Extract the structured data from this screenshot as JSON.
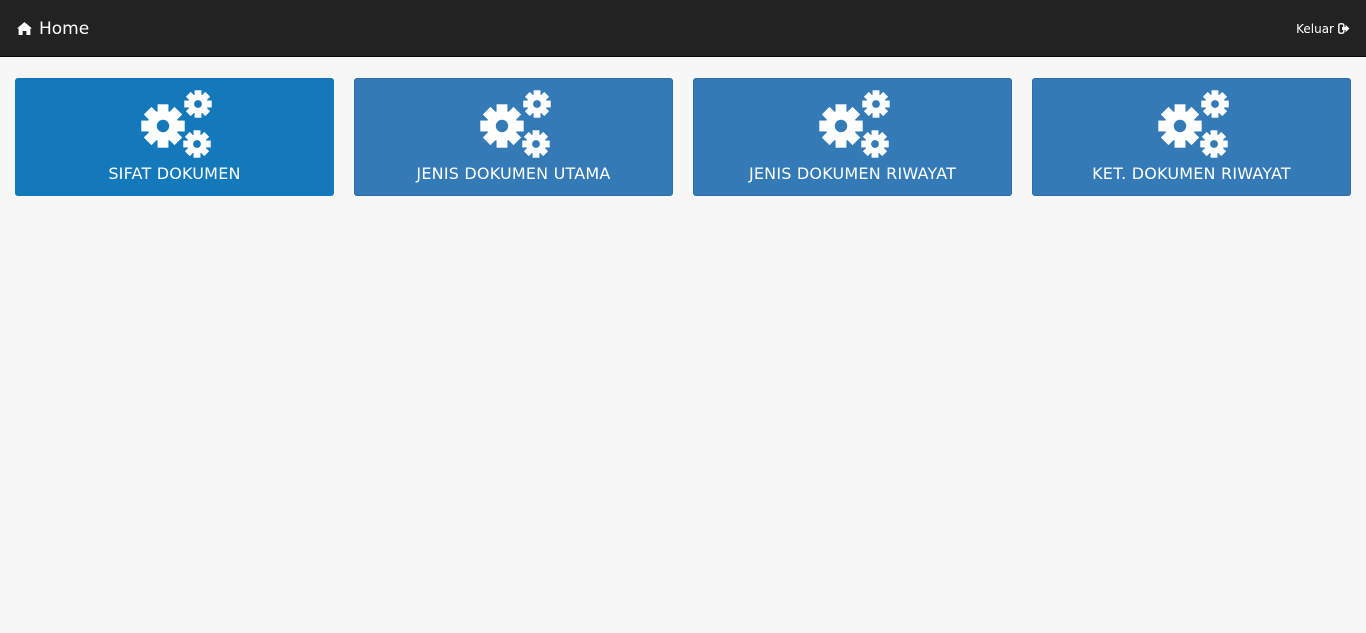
{
  "navbar": {
    "brand_label": "Home",
    "brand_icon": "home-icon",
    "logout_label": "Keluar",
    "logout_icon": "sign-out-icon"
  },
  "tiles": [
    {
      "label": "SIFAT DOKUMEN",
      "icon": "gears-icon",
      "active": true
    },
    {
      "label": "JENIS DOKUMEN UTAMA",
      "icon": "gears-icon",
      "active": false
    },
    {
      "label": "JENIS DOKUMEN RIWAYAT",
      "icon": "gears-icon",
      "active": false
    },
    {
      "label": "KET. DOKUMEN RIWAYAT",
      "icon": "gears-icon",
      "active": false
    }
  ],
  "colors": {
    "navbar_bg": "#222222",
    "tile_bg": "#337ab7",
    "tile_active_bg": "#1379bb",
    "page_bg": "#f7f7f7"
  }
}
